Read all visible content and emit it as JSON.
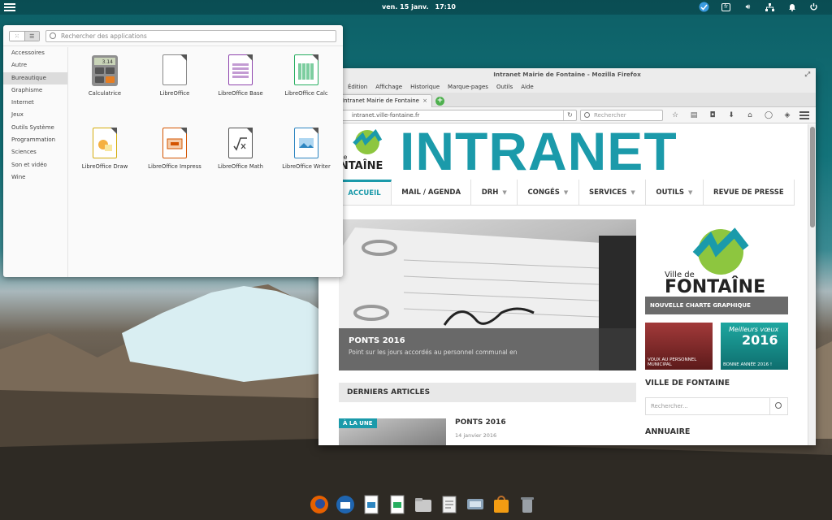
{
  "panel": {
    "date": "ven. 15 janv.",
    "time": "17:10",
    "keyboard": "fr"
  },
  "launcher": {
    "search_placeholder": "Rechercher des applications",
    "categories": [
      "Accessoires",
      "Autre",
      "Bureautique",
      "Graphisme",
      "Internet",
      "Jeux",
      "Outils Système",
      "Programmation",
      "Sciences",
      "Son et vidéo",
      "Wine"
    ],
    "selected_category": "Bureautique",
    "apps": [
      "Calculatrice",
      "LibreOffice",
      "LibreOffice Base",
      "LibreOffice Calc",
      "LibreOffice Draw",
      "LibreOffice Impress",
      "LibreOffice Math",
      "LibreOffice Writer"
    ],
    "calc_display": "3.14"
  },
  "firefox": {
    "title": "Intranet Mairie de Fontaine - Mozilla Firefox",
    "menu": [
      "Édition",
      "Affichage",
      "Historique",
      "Marque-pages",
      "Outils",
      "Aide"
    ],
    "tab_title": "Intranet Mairie de Fontaine",
    "url": "intranet.ville-fontaine.fr",
    "search_placeholder": "Rechercher"
  },
  "site": {
    "logo_small": "Ville de",
    "logo_big": "FONTAÎNE",
    "banner": "INTRANET",
    "nav": [
      "ACCUEIL",
      "MAIL / AGENDA",
      "DRH",
      "CONGÉS",
      "SERVICES",
      "OUTILS",
      "REVUE DE PRESSE"
    ],
    "hero_title": "PONTS 2016",
    "hero_text": "Point sur les jours accordés au personnel communal en",
    "section_title": "DERNIERS ARTICLES",
    "badge": "À LA UNE",
    "article_title": "PONTS 2016",
    "article_date": "14 janvier 2016",
    "side_logo_small": "Ville de",
    "side_logo_big": "FONTAÎNE",
    "side_banner": "NOUVELLE CHARTE GRAPHIQUE",
    "thumb_a": "VOUX AU PERSONNEL MUNICIPAL",
    "thumb_b": "BONNE ANNÉE 2016 !",
    "thumb_b_big": "2016",
    "thumb_b_top": "Meilleurs vœux",
    "side_heading": "VILLE DE FONTAINE",
    "side_search_placeholder": "Rechercher...",
    "side_heading2": "ANNUAIRE"
  },
  "colors": {
    "accent": "#1b9aaa",
    "logo_green": "#8dc63f"
  }
}
